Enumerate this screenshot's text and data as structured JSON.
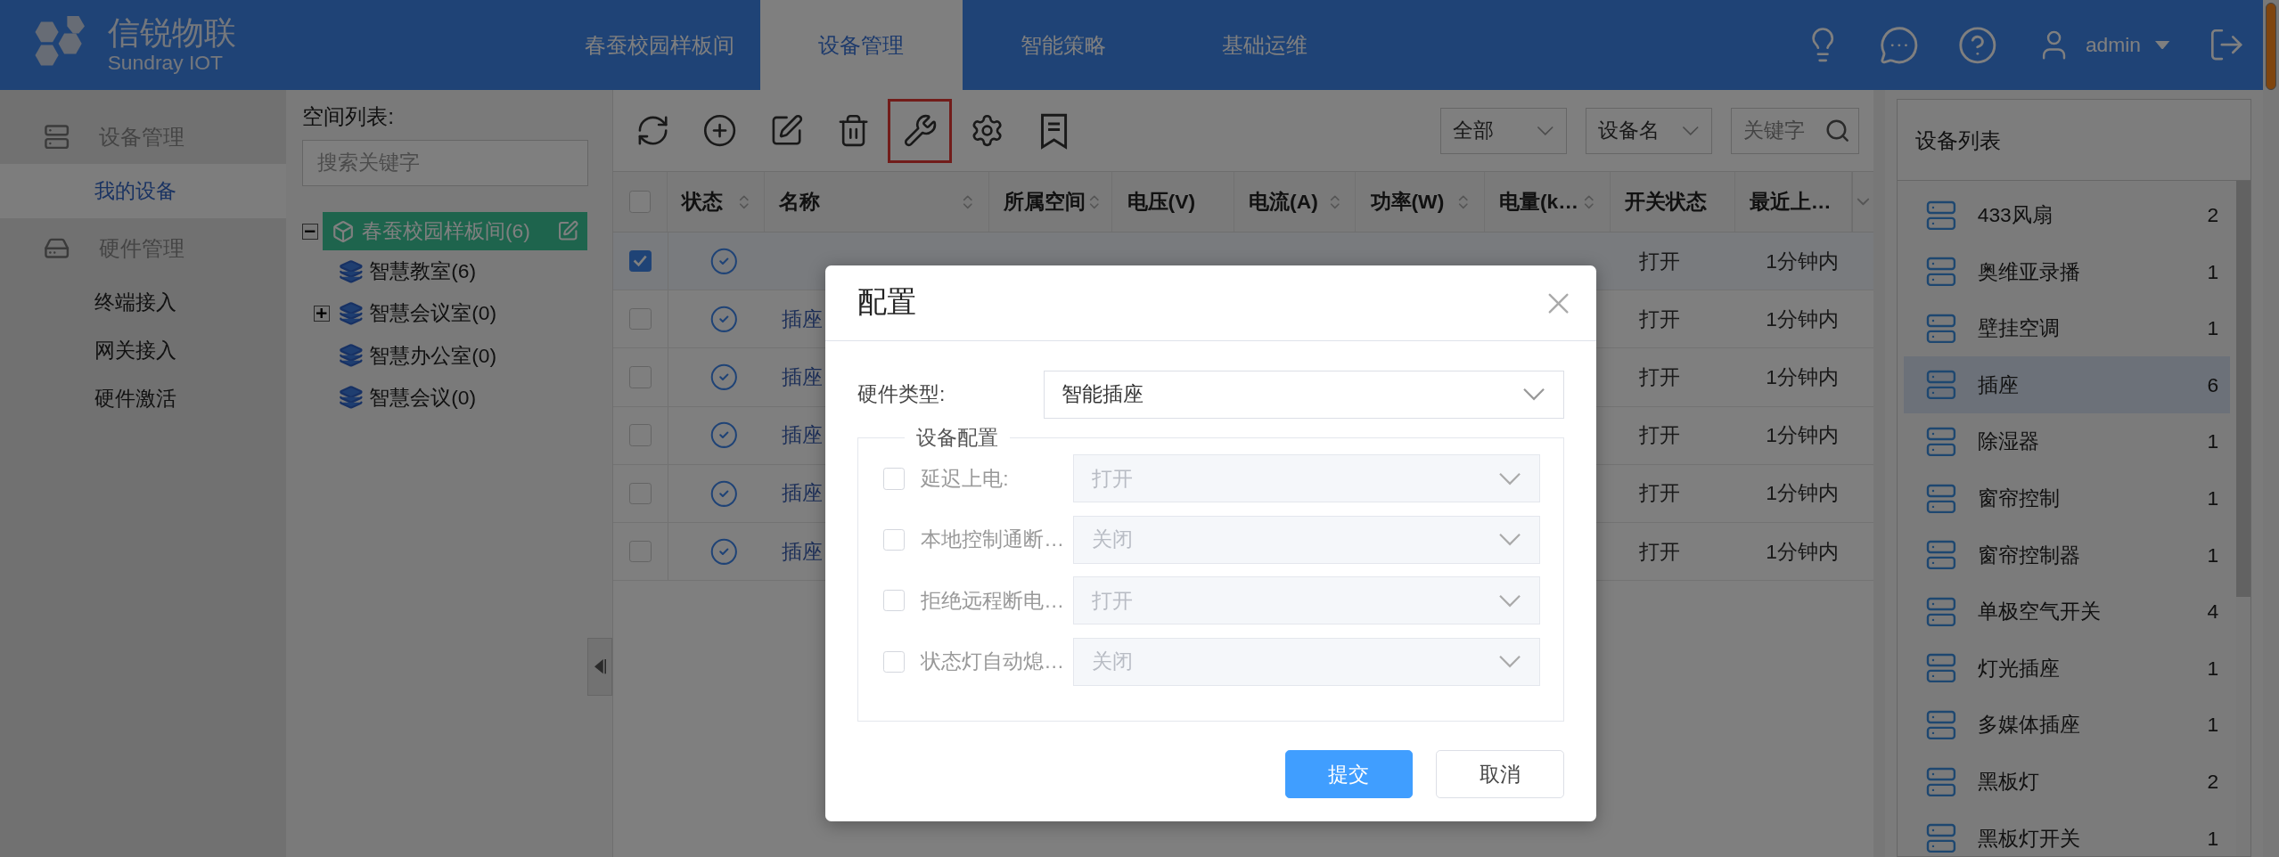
{
  "header": {
    "logo": {
      "name": "信锐物联",
      "subtitle": "Sundray IOT"
    },
    "nav": [
      {
        "label": "春蚕校园样板间",
        "selected": false
      },
      {
        "label": "设备管理",
        "selected": true
      },
      {
        "label": "智能策略",
        "selected": false
      },
      {
        "label": "基础运维",
        "selected": false
      }
    ],
    "user": "admin"
  },
  "sidebar": {
    "sections": [
      {
        "title": "设备管理",
        "kind": "devices",
        "items": [
          {
            "label": "我的设备",
            "selected": true
          }
        ]
      },
      {
        "title": "硬件管理",
        "kind": "hardware",
        "items": [
          {
            "label": "终端接入",
            "selected": false
          },
          {
            "label": "网关接入",
            "selected": false
          },
          {
            "label": "硬件激活",
            "selected": false
          }
        ]
      }
    ]
  },
  "space_panel": {
    "title": "空间列表:",
    "search": {
      "placeholder": "搜索关键字"
    },
    "tree": [
      {
        "label": "春蚕校园样板间(6)",
        "selected": true,
        "expanded": true,
        "children": [
          {
            "label": "智慧教室(6)",
            "selected": false,
            "kind": "leaf"
          },
          {
            "label": "智慧会议室(0)",
            "selected": false,
            "kind": "group",
            "expanded": false
          },
          {
            "label": "智慧办公室(0)",
            "selected": false,
            "kind": "leaf"
          },
          {
            "label": "智慧会议(0)",
            "selected": false,
            "kind": "leaf"
          }
        ]
      }
    ]
  },
  "toolbar": {
    "tools": [
      {
        "kind": "refresh",
        "selected": false
      },
      {
        "kind": "add",
        "selected": false
      },
      {
        "kind": "edit",
        "selected": false
      },
      {
        "kind": "delete",
        "selected": false
      },
      {
        "kind": "tools",
        "selected": true
      },
      {
        "kind": "settings",
        "selected": false
      },
      {
        "kind": "list",
        "selected": false
      }
    ],
    "filters": [
      {
        "kind": "select",
        "value": "全部"
      },
      {
        "kind": "select",
        "value": "设备名"
      },
      {
        "kind": "search",
        "placeholder": "关键字"
      }
    ]
  },
  "table": {
    "columns": [
      {
        "label": "状态",
        "sortable": true
      },
      {
        "label": "名称",
        "sortable": true
      },
      {
        "label": "所属空间",
        "sortable": true
      },
      {
        "label": "电压(V)",
        "sortable": false
      },
      {
        "label": "电流(A)",
        "sortable": true
      },
      {
        "label": "功率(W)",
        "sortable": true
      },
      {
        "label": "电量(k…",
        "sortable": true
      },
      {
        "label": "开关状态",
        "sortable": false
      },
      {
        "label": "最近上…",
        "sortable": false
      }
    ],
    "all_selected": false,
    "rows": [
      {
        "selected": true,
        "switch": "打开",
        "last_seen": "1分钟内"
      },
      {
        "selected": false,
        "name": "插座",
        "switch": "打开",
        "last_seen": "1分钟内"
      },
      {
        "selected": false,
        "name": "插座",
        "switch": "打开",
        "last_seen": "1分钟内"
      },
      {
        "selected": false,
        "name": "插座",
        "switch": "打开",
        "last_seen": "1分钟内"
      },
      {
        "selected": false,
        "name": "插座",
        "switch": "打开",
        "last_seen": "1分钟内"
      },
      {
        "selected": false,
        "name": "插座",
        "switch": "打开",
        "last_seen": "1分钟内"
      }
    ]
  },
  "device_list": {
    "title": "设备列表",
    "items": [
      {
        "name": "433风扇",
        "count": "2",
        "selected": false
      },
      {
        "name": "奥维亚录播",
        "count": "1",
        "selected": false
      },
      {
        "name": "壁挂空调",
        "count": "1",
        "selected": false
      },
      {
        "name": "插座",
        "count": "6",
        "selected": true
      },
      {
        "name": "除湿器",
        "count": "1",
        "selected": false
      },
      {
        "name": "窗帘控制",
        "count": "1",
        "selected": false
      },
      {
        "name": "窗帘控制器",
        "count": "1",
        "selected": false
      },
      {
        "name": "单极空气开关",
        "count": "4",
        "selected": false
      },
      {
        "name": "灯光插座",
        "count": "1",
        "selected": false
      },
      {
        "name": "多媒体插座",
        "count": "1",
        "selected": false
      },
      {
        "name": "黑板灯",
        "count": "2",
        "selected": false
      },
      {
        "name": "黑板灯开关",
        "count": "1",
        "selected": false
      }
    ]
  },
  "dialog": {
    "title": "配置",
    "hardware_type": {
      "label": "硬件类型:",
      "value": "智能插座"
    },
    "group": {
      "legend": "设备配置",
      "options": [
        {
          "label": "延迟上电:",
          "checked": false,
          "value": "打开",
          "disabled": true
        },
        {
          "label": "本地控制通断…",
          "checked": false,
          "value": "关闭",
          "disabled": true
        },
        {
          "label": "拒绝远程断电…",
          "checked": false,
          "value": "打开",
          "disabled": true
        },
        {
          "label": "状态灯自动熄…",
          "checked": false,
          "value": "关闭",
          "disabled": true
        }
      ]
    },
    "buttons": [
      {
        "label": "提交",
        "kind": "primary"
      },
      {
        "label": "取消",
        "kind": "default"
      }
    ]
  }
}
